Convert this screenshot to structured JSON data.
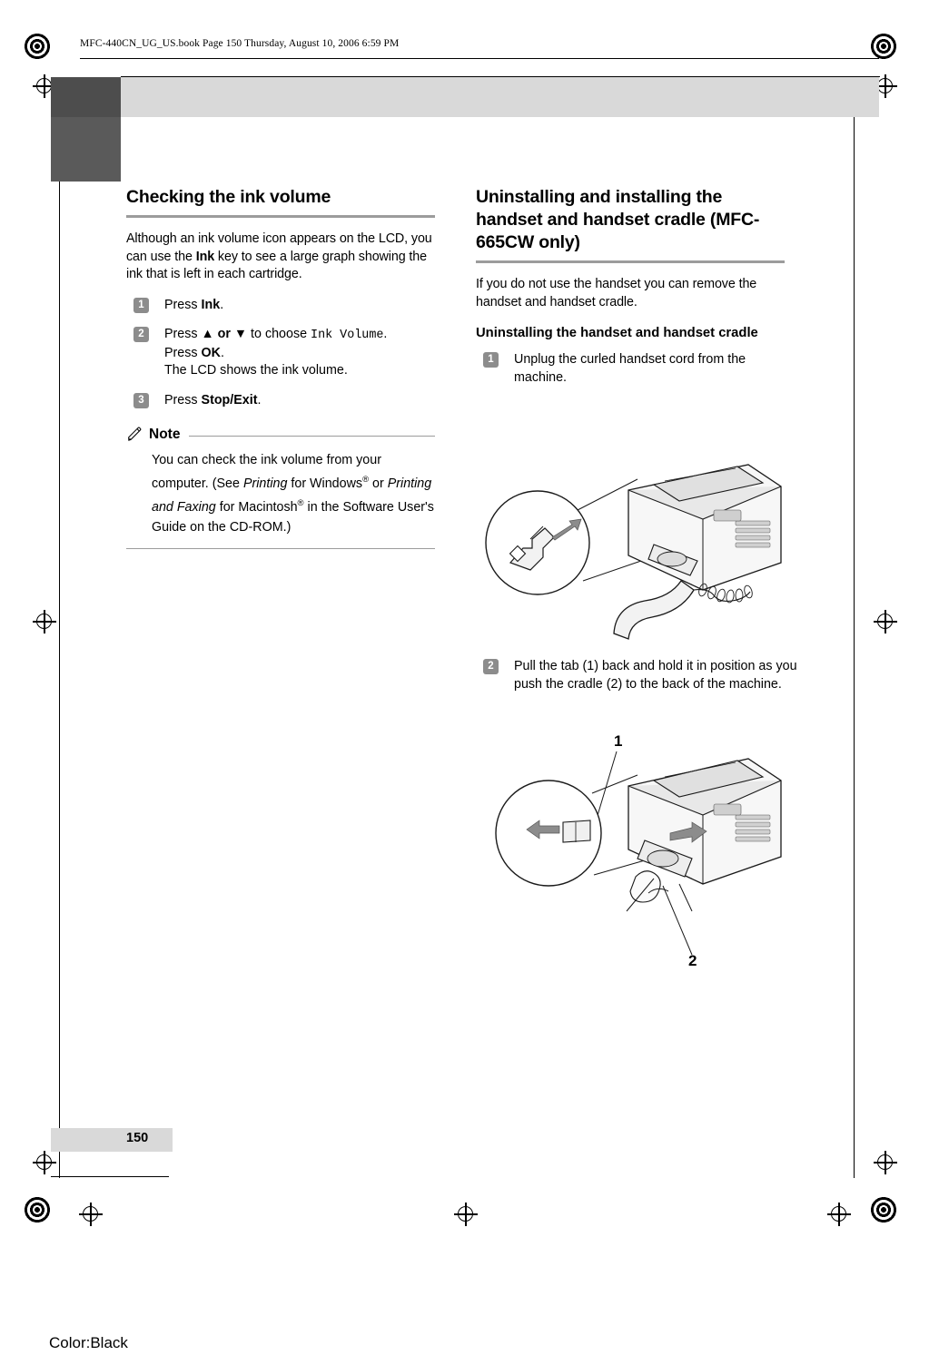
{
  "header": {
    "file_line": "MFC-440CN_UG_US.book  Page 150  Thursday, August 10, 2006  6:59 PM"
  },
  "footer": {
    "page_number": "150",
    "color_note": "Color:Black"
  },
  "left_column": {
    "heading": "Checking the ink volume",
    "intro_part1": "Although an ink volume icon appears on the LCD, you can use the ",
    "intro_bold": "Ink",
    "intro_part2": " key to see a large graph showing the ink that is left in each cartridge.",
    "steps": [
      {
        "num": "1",
        "pre": "Press ",
        "bold": "Ink",
        "post": "."
      },
      {
        "num": "2",
        "pre": "Press ",
        "arrows": "▲ or ▼",
        "mid": " to choose ",
        "mono": "Ink Volume",
        "post": ".",
        "line2_pre": "Press ",
        "line2_bold": "OK",
        "line2_post": ".",
        "line3": "The LCD shows the ink volume."
      },
      {
        "num": "3",
        "pre": "Press ",
        "bold": "Stop/Exit",
        "post": "."
      }
    ],
    "note": {
      "title": "Note",
      "text_1": "You can check the ink volume from your computer. (See ",
      "italic_1": "Printing",
      "text_2": " for Windows",
      "sup_1": "®",
      "text_3": " or ",
      "italic_2": "Printing and Faxing",
      "text_4": " for Macintosh",
      "sup_2": "®",
      "text_5": " in the Software User's Guide on the CD-ROM.)"
    }
  },
  "right_column": {
    "heading": "Uninstalling and installing the handset and handset cradle (MFC-665CW only)",
    "intro": "If you do not use the handset you can remove the handset and handset cradle.",
    "subheading": "Uninstalling the handset and handset cradle",
    "steps": [
      {
        "num": "1",
        "text": "Unplug the curled handset cord from the machine."
      },
      {
        "num": "2",
        "text": "Pull the tab (1) back and hold it in position as you push the cradle (2) to the back of the machine."
      }
    ],
    "figure_labels": {
      "label_1": "1",
      "label_2": "2"
    }
  },
  "colors": {
    "rule_gray": "#9c9c9c",
    "bar_gray": "#d9d9d9",
    "block_dark": "#5a5a5a",
    "step_badge": "#8c8c8c"
  }
}
